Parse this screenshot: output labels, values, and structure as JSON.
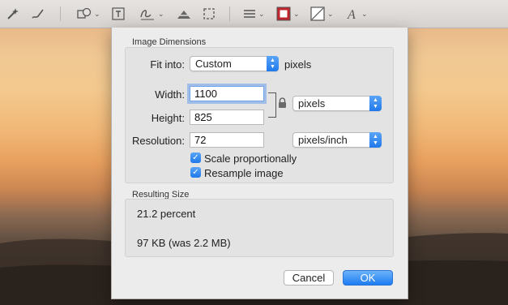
{
  "toolbar": {
    "tools": [
      "magic-wand-icon",
      "pen-icon",
      "shapes-icon",
      "text-icon",
      "sign-icon",
      "adjust-color-icon",
      "crop-icon",
      "line-style-icon",
      "border-color-icon",
      "fill-color-icon",
      "text-style-icon"
    ]
  },
  "dialog": {
    "image_dimensions_title": "Image Dimensions",
    "fit_into_label": "Fit into:",
    "fit_into_value": "Custom",
    "fit_into_unit": "pixels",
    "width_label": "Width:",
    "width_value": "1100",
    "height_label": "Height:",
    "height_value": "825",
    "size_unit_value": "pixels",
    "resolution_label": "Resolution:",
    "resolution_value": "72",
    "resolution_unit_value": "pixels/inch",
    "scale_label": "Scale proportionally",
    "scale_checked": true,
    "resample_label": "Resample image",
    "resample_checked": true,
    "resulting_size_title": "Resulting Size",
    "percent_text": "21.2 percent",
    "size_text": "97 KB (was 2.2 MB)",
    "cancel_label": "Cancel",
    "ok_label": "OK"
  },
  "colors": {
    "accent": "#1f78ea",
    "border_swatch": "#c0262d"
  }
}
